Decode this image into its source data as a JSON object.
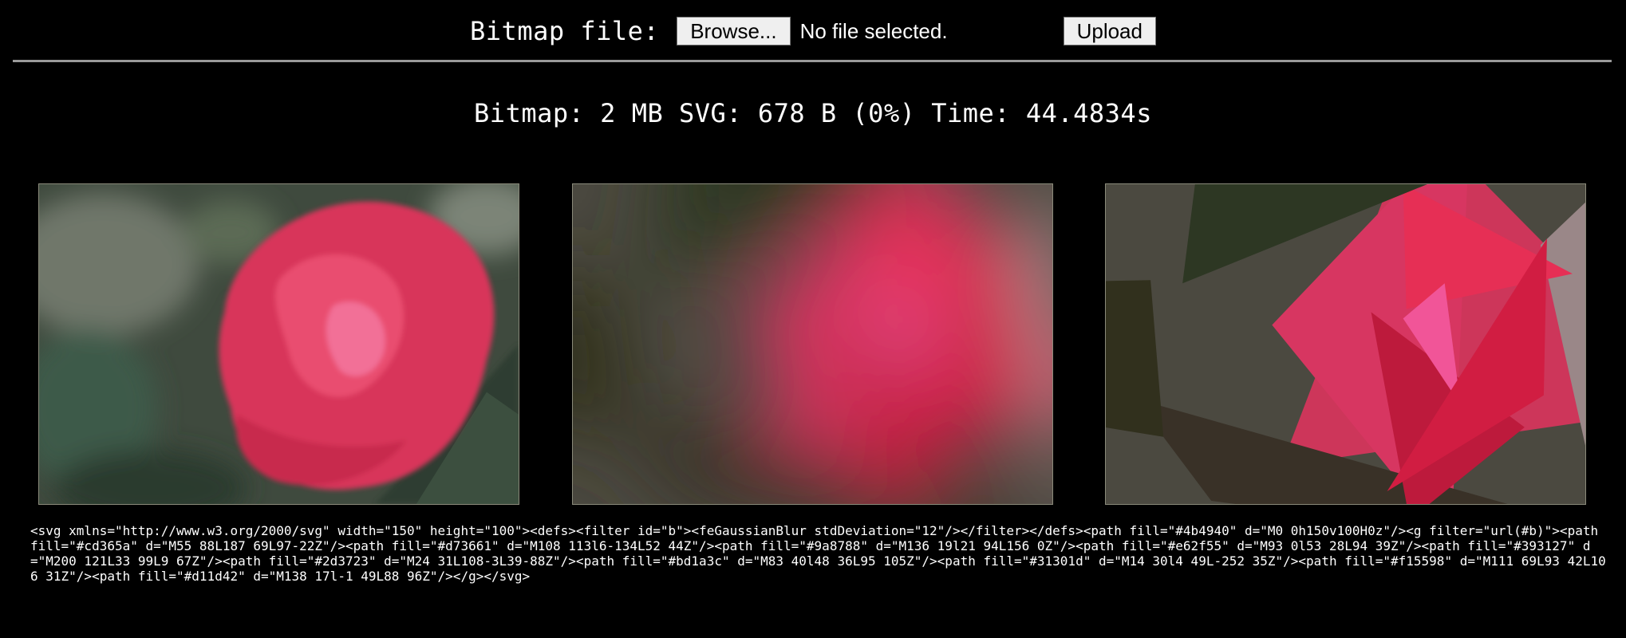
{
  "upload_form": {
    "label": "Bitmap file:",
    "browse_label": "Browse...",
    "file_status": "No file selected.",
    "upload_label": "Upload"
  },
  "stats": {
    "text": "Bitmap: 2 MB SVG: 678 B (0%) Time: 44.4834s"
  },
  "images": [
    {
      "kind": "original-bitmap"
    },
    {
      "kind": "blurred-svg-render"
    },
    {
      "kind": "unblurred-svg-render"
    }
  ],
  "svg_source": "<svg xmlns=\"http://www.w3.org/2000/svg\" width=\"150\" height=\"100\"><defs><filter id=\"b\"><feGaussianBlur stdDeviation=\"12\"/></filter></defs><path fill=\"#4b4940\" d=\"M0 0h150v100H0z\"/><g filter=\"url(#b)\"><path fill=\"#cd365a\" d=\"M55 88L187 69L97-22Z\"/><path fill=\"#d73661\" d=\"M108 113l6-134L52 44Z\"/><path fill=\"#9a8788\" d=\"M136 19l21 94L156 0Z\"/><path fill=\"#e62f55\" d=\"M93 0l53 28L94 39Z\"/><path fill=\"#393127\" d=\"M200 121L33 99L9 67Z\"/><path fill=\"#2d3723\" d=\"M24 31L108-3L39-88Z\"/><path fill=\"#bd1a3c\" d=\"M83 40l48 36L95 105Z\"/><path fill=\"#31301d\" d=\"M14 30l4 49L-252 35Z\"/><path fill=\"#f15598\" d=\"M111 69L93 42L106 31Z\"/><path fill=\"#d11d42\" d=\"M138 17l-1 49L88 96Z\"/></g></svg>",
  "colors": {
    "background": "#000000",
    "text": "#ffffff",
    "divider": "#9a9a9a",
    "button_bg": "#efefef"
  }
}
